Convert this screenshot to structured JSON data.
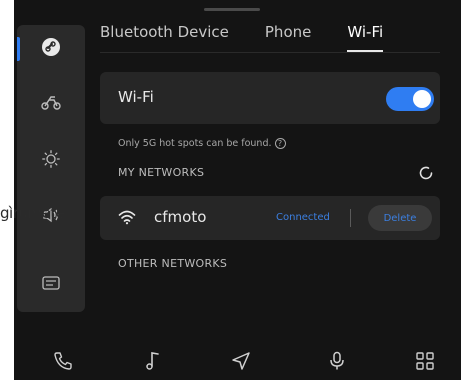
{
  "overlay": {
    "text": "gìrumète"
  },
  "tabs": [
    {
      "label": "Bluetooth Device"
    },
    {
      "label": "Phone"
    },
    {
      "label": "Wi-Fi"
    }
  ],
  "active_tab": "Wi-Fi",
  "sidebar": {
    "items": [
      {
        "icon": "link-icon",
        "active": true
      },
      {
        "icon": "motorcycle-icon",
        "active": false
      },
      {
        "icon": "brightness-icon",
        "active": false
      },
      {
        "icon": "volume-icon",
        "active": false
      },
      {
        "icon": "display-icon",
        "active": false
      }
    ]
  },
  "wifi": {
    "label": "Wi-Fi",
    "enabled": true,
    "hint": "Only 5G hot spots can be found.",
    "hint_icon": "question-icon"
  },
  "my_networks": {
    "title": "MY NETWORKS",
    "refresh_icon": "refresh-icon",
    "items": [
      {
        "ssid": "cfmoto",
        "status": "Connected",
        "action": "Delete"
      }
    ]
  },
  "other_networks": {
    "title": "OTHER NETWORKS"
  },
  "bottom_nav": [
    {
      "icon": "phone-icon"
    },
    {
      "icon": "music-icon"
    },
    {
      "icon": "navigation-icon"
    },
    {
      "icon": "microphone-icon"
    },
    {
      "icon": "apps-grid-icon"
    }
  ],
  "colors": {
    "background": "#141414",
    "card": "#262626",
    "accent": "#2f7df2",
    "link": "#3c7fe0"
  }
}
